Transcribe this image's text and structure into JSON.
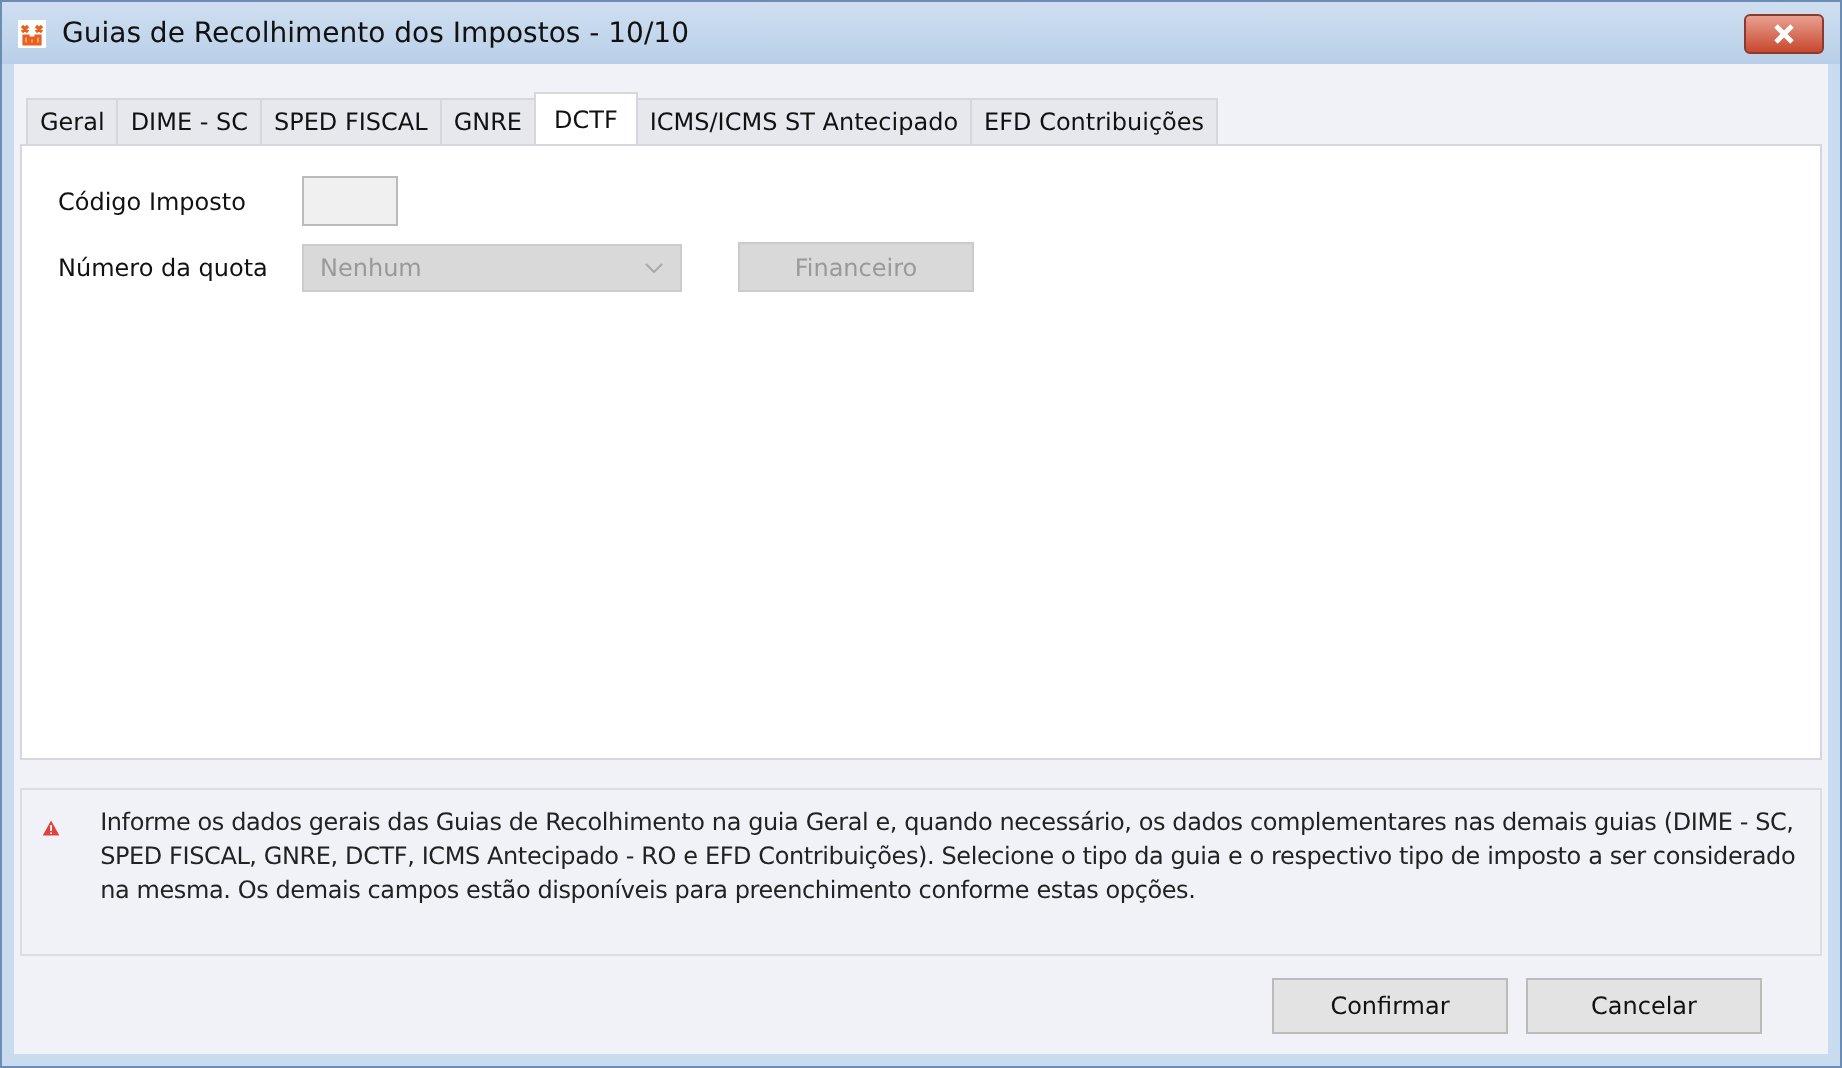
{
  "window": {
    "title": "Guias de Recolhimento dos Impostos - 10/10"
  },
  "tabs": [
    {
      "label": "Geral",
      "selected": false
    },
    {
      "label": "DIME - SC",
      "selected": false
    },
    {
      "label": "SPED FISCAL",
      "selected": false
    },
    {
      "label": "GNRE",
      "selected": false
    },
    {
      "label": "DCTF",
      "selected": true
    },
    {
      "label": "ICMS/ICMS ST Antecipado",
      "selected": false
    },
    {
      "label": "EFD Contribuições",
      "selected": false
    }
  ],
  "form": {
    "codigo_label": "Código Imposto",
    "quota_label": "Número da quota",
    "quota_value": "Nenhum",
    "quota_disabled": true,
    "financeiro_button": "Financeiro",
    "financeiro_disabled": true
  },
  "message": "Informe os dados gerais das Guias de Recolhimento na guia Geral e, quando necessário, os dados complementares nas demais guias (DIME - SC, SPED FISCAL, GNRE, DCTF, ICMS Antecipado - RO e EFD Contribuições). Selecione o tipo da guia e o respectivo tipo de imposto a ser considerado na mesma. Os demais campos estão disponíveis para preenchimento conforme estas opções.",
  "buttons": [
    "Confirmar",
    "Cancelar"
  ]
}
